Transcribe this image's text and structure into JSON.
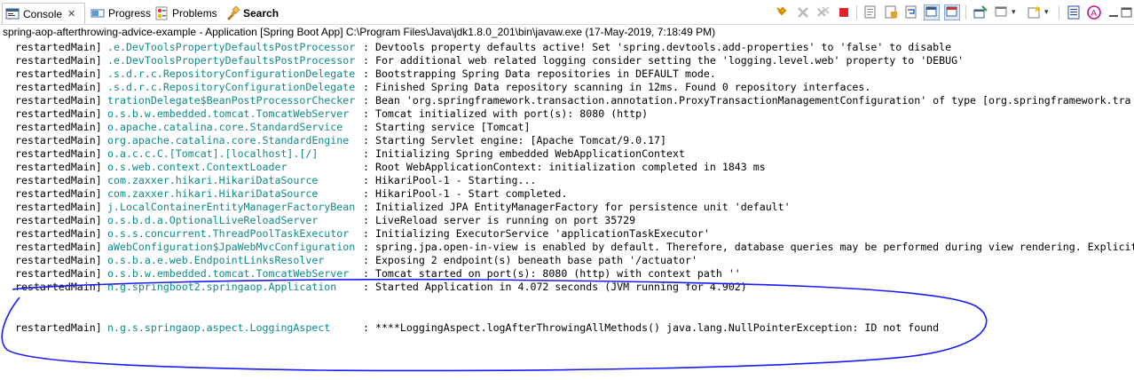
{
  "tabs": [
    {
      "label": "Console",
      "close": "✕"
    },
    {
      "label": "Progress"
    },
    {
      "label": "Problems"
    },
    {
      "label": "Search"
    }
  ],
  "title": "spring-aop-afterthrowing-advice-example - Application [Spring Boot App] C:\\Program Files\\Java\\jdk1.8.0_201\\bin\\javaw.exe (17-May-2019, 7:18:49 PM)",
  "toolbar_icons": [
    "pin-icon",
    "remove-launch-icon",
    "remove-all-terminated-icon",
    "terminate-icon",
    "clear-console-icon",
    "scroll-lock-icon",
    "word-wrap-icon",
    "show-on-stdout-icon",
    "show-on-stderr-icon",
    "pin-console-icon",
    "display-selected-console-icon",
    "open-console-icon",
    "view-menu-icon",
    "maximize-icon"
  ],
  "console_lines": [
    {
      "thread": "restartedMain]",
      "logger": ".e.DevToolsPropertyDefaultsPostProcessor",
      "msg": ": Devtools property defaults active! Set 'spring.devtools.add-properties' to 'false' to disable"
    },
    {
      "thread": "restartedMain]",
      "logger": ".e.DevToolsPropertyDefaultsPostProcessor",
      "msg": ": For additional web related logging consider setting the 'logging.level.web' property to 'DEBUG'"
    },
    {
      "thread": "restartedMain]",
      "logger": ".s.d.r.c.RepositoryConfigurationDelegate",
      "msg": ": Bootstrapping Spring Data repositories in DEFAULT mode."
    },
    {
      "thread": "restartedMain]",
      "logger": ".s.d.r.c.RepositoryConfigurationDelegate",
      "msg": ": Finished Spring Data repository scanning in 12ms. Found 0 repository interfaces."
    },
    {
      "thread": "restartedMain]",
      "logger": "trationDelegate$BeanPostProcessorChecker",
      "msg": ": Bean 'org.springframework.transaction.annotation.ProxyTransactionManagementConfiguration' of type [org.springframework.tra"
    },
    {
      "thread": "restartedMain]",
      "logger": "o.s.b.w.embedded.tomcat.TomcatWebServer",
      "msg": ": Tomcat initialized with port(s): 8080 (http)"
    },
    {
      "thread": "restartedMain]",
      "logger": "o.apache.catalina.core.StandardService",
      "msg": ": Starting service [Tomcat]"
    },
    {
      "thread": "restartedMain]",
      "logger": "org.apache.catalina.core.StandardEngine",
      "msg": ": Starting Servlet engine: [Apache Tomcat/9.0.17]"
    },
    {
      "thread": "restartedMain]",
      "logger": "o.a.c.c.C.[Tomcat].[localhost].[/]",
      "msg": ": Initializing Spring embedded WebApplicationContext"
    },
    {
      "thread": "restartedMain]",
      "logger": "o.s.web.context.ContextLoader",
      "msg": ": Root WebApplicationContext: initialization completed in 1843 ms"
    },
    {
      "thread": "restartedMain]",
      "logger": "com.zaxxer.hikari.HikariDataSource",
      "msg": ": HikariPool-1 - Starting..."
    },
    {
      "thread": "restartedMain]",
      "logger": "com.zaxxer.hikari.HikariDataSource",
      "msg": ": HikariPool-1 - Start completed."
    },
    {
      "thread": "restartedMain]",
      "logger": "j.LocalContainerEntityManagerFactoryBean",
      "msg": ": Initialized JPA EntityManagerFactory for persistence unit 'default'"
    },
    {
      "thread": "restartedMain]",
      "logger": "o.s.b.d.a.OptionalLiveReloadServer",
      "msg": ": LiveReload server is running on port 35729"
    },
    {
      "thread": "restartedMain]",
      "logger": "o.s.s.concurrent.ThreadPoolTaskExecutor",
      "msg": ": Initializing ExecutorService 'applicationTaskExecutor'"
    },
    {
      "thread": "restartedMain]",
      "logger": "aWebConfiguration$JpaWebMvcConfiguration",
      "msg": ": spring.jpa.open-in-view is enabled by default. Therefore, database queries may be performed during view rendering. Explicit"
    },
    {
      "thread": "restartedMain]",
      "logger": "o.s.b.a.e.web.EndpointLinksResolver",
      "msg": ": Exposing 2 endpoint(s) beneath base path '/actuator'"
    },
    {
      "thread": "restartedMain]",
      "logger": "o.s.b.w.embedded.tomcat.TomcatWebServer",
      "msg": ": Tomcat started on port(s): 8080 (http) with context path ''"
    },
    {
      "thread": "restartedMain]",
      "logger": "n.g.springboot2.springaop.Application",
      "msg": ": Started Application in 4.072 seconds (JVM running for 4.902)"
    },
    {
      "thread": "restartedMain]",
      "logger": "n.g.s.springaop.aspect.LoggingAspect",
      "msg": ": ****LoggingAspect.logAfterThrowingAllMethods() java.lang.NullPointerException: ID not found"
    }
  ],
  "colors": {
    "logger": "#0e8a8a",
    "annotation": "#1a1aff"
  }
}
